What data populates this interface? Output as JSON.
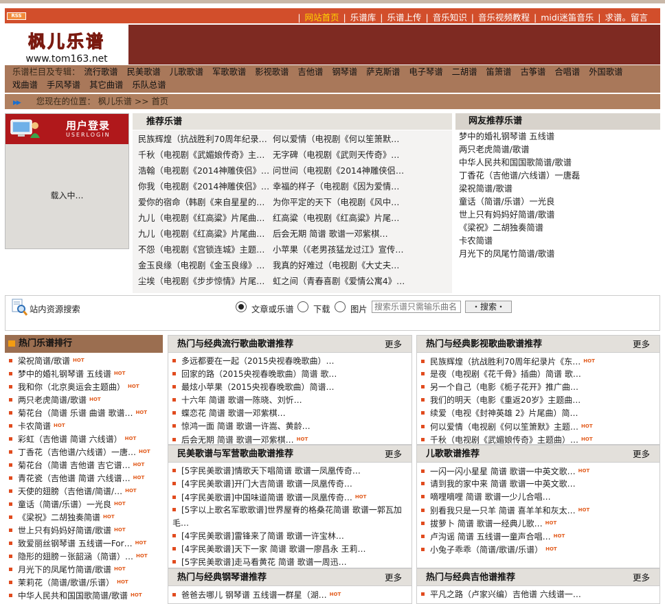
{
  "topbar": {
    "rss": "RSS",
    "nav": [
      {
        "label": "网站首页",
        "current": true
      },
      {
        "label": "乐谱库"
      },
      {
        "label": "乐谱上传"
      },
      {
        "label": "音乐知识"
      },
      {
        "label": "音乐视频教程"
      },
      {
        "label": "midi迷笛音乐"
      },
      {
        "label": "求谱。留言"
      }
    ]
  },
  "logo": {
    "title": "枫儿乐谱",
    "url": "www.tom163.net"
  },
  "categories": {
    "label": "乐谱栏目及专辑：",
    "items": [
      "流行歌谱",
      "民美歌谱",
      "儿歌歌谱",
      "军歌歌谱",
      "影视歌谱",
      "吉他谱",
      "钢琴谱",
      "萨克斯谱",
      "电子琴谱",
      "二胡谱",
      "笛箫谱",
      "古筝谱",
      "合唱谱",
      "外国歌谱",
      "戏曲谱",
      "手风琴谱",
      "其它曲谱",
      "乐队总谱"
    ]
  },
  "breadcrumb": {
    "prefix": "您现在的位置：",
    "site": "枫儿乐谱",
    "sep": ">>",
    "page": "首页"
  },
  "login": {
    "title": "用户登录",
    "subtitle": "USERLOGIN",
    "loading": "载入中…"
  },
  "recommend": {
    "title": "推荐乐谱",
    "rows": [
      [
        "民族辉煌（抗战胜利70周年纪录片…",
        "何以爱情（电视剧《何以笙箫默》…"
      ],
      [
        "千秋（电视剧《武媚娘传奇》主题…",
        "无字碑（电视剧《武则天传奇》主…"
      ],
      [
        "浩翰（电视剧《2014神雕侠侣》主…",
        "问世间（电视剧《2014神雕侠侣》…"
      ],
      [
        "你我（电视剧《2014神雕侠侣》片…",
        "幸福的样子（电视剧《因为爱情有…"
      ],
      [
        "爱你的宿命（韩剧《来自星星的你…",
        "为你平定的天下（电视剧《风中奇…"
      ],
      [
        "九儿（电视剧《红高粱》片尾曲）…",
        "红高粱（电视剧《红高粱》片尾曲…"
      ],
      [
        "九儿（电视剧《红高粱》片尾曲）…",
        "后会无期 简谱 歌谱一邓紫棋…"
      ],
      [
        "不怨（电视剧《宫锁连城》主题曲…",
        "小苹果（《老男孩猛龙过江》宣传…"
      ],
      [
        "金玉良缘（电视剧《金玉良缘》主…",
        "我真的好难过（电视剧《大丈夫》…"
      ],
      [
        "尘埃（电视剧《步步惊情》片尾曲…",
        "虹之间（青春喜剧《爱情公寓4》插…"
      ]
    ]
  },
  "user_recommend": {
    "title": "网友推荐乐谱",
    "items": [
      "梦中的婚礼钢琴谱 五线谱",
      "两只老虎简谱/歌谱",
      "中华人民共和国国歌简谱/歌谱",
      "丁香花（吉他谱/六线谱）一唐磊",
      "梁祝简谱/歌谱",
      "童话（简谱/乐谱）一光良",
      "世上只有妈妈好简谱/歌谱",
      "《梁祝》二胡独奏简谱",
      "卡农简谱",
      "月光下的凤尾竹简谱/歌谱"
    ]
  },
  "search": {
    "label": "站内资源搜索",
    "options": [
      "文章或乐谱",
      "下载",
      "图片"
    ],
    "placeholder": "搜索乐谱只需输乐曲名",
    "button": "・搜索・"
  },
  "hot": {
    "title": "热门乐谱排行",
    "hot_badge": "HOT",
    "items": [
      "梁祝简谱/歌谱",
      "梦中的婚礼钢琴谱 五线谱",
      "我和你（北京奥运会主题曲）",
      "两只老虎简谱/歌谱",
      "菊花台（简谱 乐谱 曲谱 歌谱…",
      "卡农简谱",
      "彩虹（吉他谱 简谱 六线谱）",
      "丁香花（吉他谱/六线谱）一唐…",
      "菊花台（简谱 吉他谱 吉它谱…",
      "青花瓷（吉他谱 简谱 六线谱…",
      "天使的翅膀（吉他谱/简谱/…",
      "童话（简谱/乐谱）一光良",
      "《梁祝》二胡独奏简谱",
      "世上只有妈妈好简谱/歌谱",
      "致爱丽丝钢琴谱 五线谱一For…",
      "隐形的翅膀－张韶涵（简谱）…",
      "月光下的凤尾竹简谱/歌谱",
      "茉莉花（简谱/歌谱/乐谱）",
      "中华人民共和国国歌简谱/歌谱"
    ]
  },
  "panels": {
    "more": "更多",
    "pop": {
      "title": "热门与经典流行歌曲歌谱推荐",
      "items": [
        {
          "t": "多远都要在一起（2015央视春晚歌曲）…",
          "hot": false
        },
        {
          "t": "回家的路（2015央视春晚歌曲）简谱 歌…",
          "hot": false
        },
        {
          "t": "最炫小苹果（2015央视春晚歌曲）简谱…",
          "hot": false
        },
        {
          "t": "十六年 简谱 歌谱一陈晓、刘忻…",
          "hot": false
        },
        {
          "t": "蝶恋花 简谱 歌谱一邓紫棋…",
          "hot": false
        },
        {
          "t": "惊鸿一面 简谱 歌谱一许嵩、黄龄…",
          "hot": false
        },
        {
          "t": "后会无期 简谱 歌谱一邓紫棋…",
          "hot": true
        }
      ]
    },
    "film": {
      "title": "热门与经典影视歌曲歌谱推荐",
      "items": [
        {
          "t": "民族辉煌（抗战胜利70周年纪录片《东…",
          "hot": true
        },
        {
          "t": "是夜（电视剧《花千骨》插曲）简谱 歌…",
          "hot": false
        },
        {
          "t": "另一个自己（电影《栀子花开》推广曲…",
          "hot": false
        },
        {
          "t": "我们的明天（电影《重返20岁》主题曲…",
          "hot": false
        },
        {
          "t": "续爱（电视《封神英雄 2》片尾曲）简…",
          "hot": false
        },
        {
          "t": "何以爱情（电视剧《何以笙箫默》主题…",
          "hot": true
        },
        {
          "t": "千秋（电视剧《武媚娘传奇》主题曲）…",
          "hot": true
        }
      ]
    },
    "folk": {
      "title": "民美歌谱与军营歌曲歌谱推荐",
      "items": [
        {
          "t": "[5字民美歌谱]情歌天下唱简谱 歌谱一凤凰传奇…",
          "hot": false
        },
        {
          "t": "[4字民美歌谱]开门大吉简谱 歌谱一凤凰传奇…",
          "hot": false
        },
        {
          "t": "[4字民美歌谱]中国味道简谱 歌谱一凤凰传奇…",
          "hot": true
        },
        {
          "t": "[5字以上歌名军歌歌谱]世界屋脊的格桑花简谱 歌谱一郭瓦加毛…",
          "hot": false,
          "wrap": true
        },
        {
          "t": "[4字民美歌谱]雷锋来了简谱 歌谱一许宝林…",
          "hot": false
        },
        {
          "t": "[4字民美歌谱]天下一家 简谱 歌谱一廖昌永 王莉…",
          "hot": false
        },
        {
          "t": "[5字民美歌谱]走马看黄花 简谱 歌谱一周迅…",
          "hot": false
        }
      ]
    },
    "kids": {
      "title": "儿歌歌谱推荐",
      "items": [
        {
          "t": "一闪一闪小星星 简谱 歌谱一中英文歌…",
          "hot": true
        },
        {
          "t": "请到我的家中来 简谱 歌谱一中英文歌…",
          "hot": false
        },
        {
          "t": "嘀哩嘀哩 简谱 歌谱一少儿合唱…",
          "hot": false
        },
        {
          "t": "别看我只是一只羊 简谱 喜羊羊和灰太…",
          "hot": true
        },
        {
          "t": "拔萝卜 简谱 歌谱一经典儿歌…",
          "hot": true
        },
        {
          "t": "卢沟谣 简谱 五线谱一童声合唱…",
          "hot": true
        },
        {
          "t": "小兔子乖乖（简谱/歌谱/乐谱）",
          "hot": true
        }
      ]
    },
    "piano": {
      "title": "热门与经典钢琴谱推荐",
      "items": [
        {
          "t": "爸爸去哪儿 钢琴谱 五线谱一群星（湖…",
          "hot": true
        }
      ]
    },
    "guitar": {
      "title": "热门与经典吉他谱推荐",
      "items": [
        {
          "t": "平凡之路（卢家兴编）吉他谱 六线谱一…",
          "hot": false
        }
      ]
    }
  },
  "colors": {
    "topbar": "#d24e2b",
    "banner": "#7e2a22",
    "catbar": "#a9785a",
    "accent": "#e25b1c",
    "current_nav": "#ffd400"
  }
}
